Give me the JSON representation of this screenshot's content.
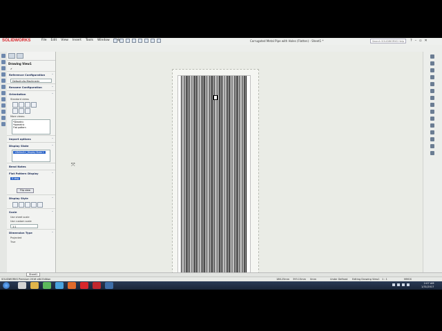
{
  "app": {
    "logo_text": "SOLIDWORKS",
    "menu": [
      "File",
      "Edit",
      "View",
      "Insert",
      "Tools",
      "Window",
      "Help"
    ],
    "document_title": "Corrugated Metal Pipe with Holes (Flatten) - Sheet1 *",
    "search_placeholder": "Search SOLIDWORKS Help"
  },
  "property_manager": {
    "title": "Drawing View1",
    "reference_configuration": {
      "header": "Reference Configuration",
      "value": "Default<As Machined>"
    },
    "rename_configuration": {
      "header": "Rename Configuration"
    },
    "orientation": {
      "header": "Orientation",
      "standard_views_label": "Standard views",
      "more_views_label": "More views:",
      "more_views": [
        "*Dimetric",
        "*Isometric",
        "Flat pattern"
      ]
    },
    "import_options": {
      "header": "Import options"
    },
    "display_state": {
      "header": "Display State",
      "value": "<Default>_Display State 1"
    },
    "bend_notes": {
      "label": "Bend Notes"
    },
    "flat_pattern_display": {
      "header": "Flat Pattern Display",
      "selected": "0 deg",
      "flip_button": "Flip view"
    },
    "display_style": {
      "header": "Display Style"
    },
    "scale": {
      "header": "Scale",
      "option_sheet": "Use sheet scale",
      "option_custom": "Use custom scale",
      "custom_value": "1:1"
    },
    "dimension_type": {
      "header": "Dimension Type",
      "option_projected": "Projected",
      "option_true": "True"
    }
  },
  "status": {
    "app_edition": "SOLIDWORKS Premium 2016 x64 Edition",
    "x": "186.25mm",
    "y": "393.15mm",
    "z": "0mm",
    "state": "Under Defined",
    "editing": "Editing Drawing View1",
    "scale": "1 : 1",
    "units": "MMGS"
  },
  "sheet_tab": "Sheet1",
  "taskbar": {
    "time": "2:07 AM",
    "date": "1/31/2017"
  },
  "colors": {
    "accent": "#2a63c7",
    "brand": "#d8262b",
    "canvas": "#eaece6",
    "taskbar": "#1a2538"
  }
}
